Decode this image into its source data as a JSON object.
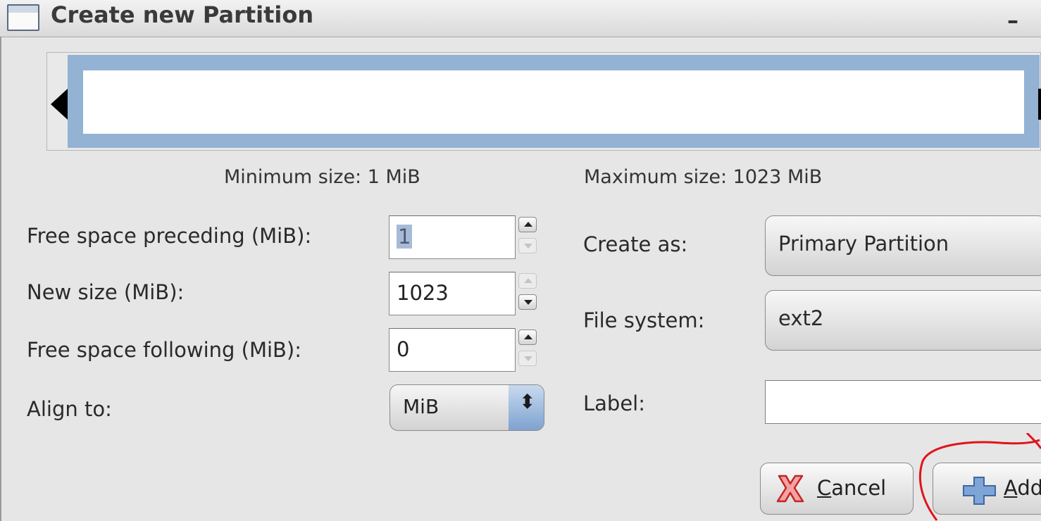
{
  "window": {
    "title": "Create new Partition",
    "minimize_label": "–"
  },
  "size_info": {
    "minimum": "Minimum size: 1 MiB",
    "maximum": "Maximum size: 1023 MiB"
  },
  "fields": {
    "free_preceding_label": "Free space preceding (MiB):",
    "free_preceding_value": "1",
    "new_size_label": "New size (MiB):",
    "new_size_value": "1023",
    "free_following_label": "Free space following (MiB):",
    "free_following_value": "0",
    "align_label": "Align to:",
    "align_value": "MiB"
  },
  "right_fields": {
    "create_as_label": "Create as:",
    "create_as_value": "Primary Partition",
    "file_system_label": "File system:",
    "file_system_value": "ext2",
    "label_label": "Label:",
    "label_value": ""
  },
  "buttons": {
    "cancel_mnemonic": "C",
    "cancel_rest": "ancel",
    "add_mnemonic": "A",
    "add_rest": "dd"
  },
  "colors": {
    "partition_bar": "#94b2d4",
    "annotation": "#e0141a",
    "dialog_bg": "#e6e6e6"
  },
  "icons": {
    "window": "window-icon",
    "cancel": "red-x-icon",
    "add": "blue-plus-icon"
  }
}
